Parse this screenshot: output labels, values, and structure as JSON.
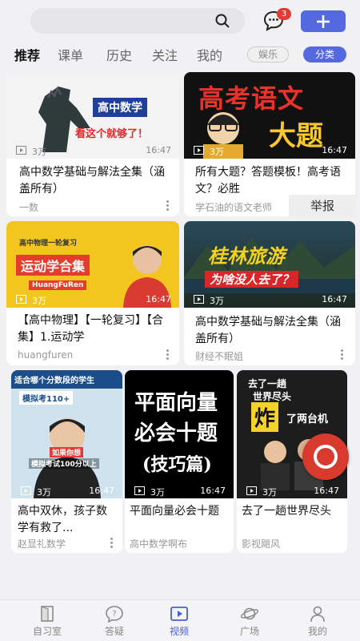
{
  "header": {
    "search_placeholder": "",
    "message_badge": "3"
  },
  "tabs": [
    {
      "label": "推荐"
    },
    {
      "label": "课单"
    },
    {
      "label": "历史"
    },
    {
      "label": "关注"
    },
    {
      "label": "我的"
    }
  ],
  "pills": {
    "entertainment": "娱乐",
    "category": "分类"
  },
  "videos": [
    {
      "views": "3万",
      "duration": "16:47",
      "title": "高中数学基础与解法全集（涵盖所有）",
      "author": "一数",
      "art": [
        "高中数学",
        "看这个就够了！"
      ]
    },
    {
      "views": "3万",
      "duration": "16:47",
      "title": "所有大题？答题模板！高考语文？必胜",
      "author": "学石油的语文老师",
      "art": [
        "高考语文",
        "大题"
      ]
    },
    {
      "views": "3万",
      "duration": "16:47",
      "title": "【高中物理】【一轮复习】【合集】1.运动学",
      "author": "huangfuren",
      "art": [
        "高中物理一轮复习",
        "运动学合集",
        "HuangFuRen"
      ]
    },
    {
      "views": "3万",
      "duration": "16:47",
      "title": "高中数学基础与解法全集（涵盖所有）",
      "author": "财经不眠姐",
      "art": [
        "桂林旅游",
        "为啥没人去了？"
      ]
    },
    {
      "views": "3万",
      "duration": "16:47",
      "title": "高中双休，孩子数学有救了...",
      "author": "赵显礼数学",
      "art": [
        "适合哪个分数段的学生",
        "模拟考110+",
        "如果你想",
        "模拟考试100分以上"
      ]
    },
    {
      "views": "3万",
      "duration": "16:47",
      "title": "平面向量必会十题",
      "author": "高中数学啊布",
      "art": [
        "平面向量",
        "必会十题",
        "(技巧篇)"
      ]
    },
    {
      "views": "3万",
      "duration": "16:47",
      "title": "去了一趟世界尽头",
      "author": "影视飓风",
      "art": [
        "去了一趟",
        "世界尽头",
        "炸",
        "了两台机"
      ]
    }
  ],
  "context_menu": {
    "report": "举报"
  },
  "bottom_nav": [
    {
      "label": "自习室"
    },
    {
      "label": "答疑"
    },
    {
      "label": "视频"
    },
    {
      "label": "广场"
    },
    {
      "label": "我的"
    }
  ],
  "colors": {
    "accent": "#5468e0",
    "fab": "#d83a2e",
    "badge": "#e53935"
  }
}
